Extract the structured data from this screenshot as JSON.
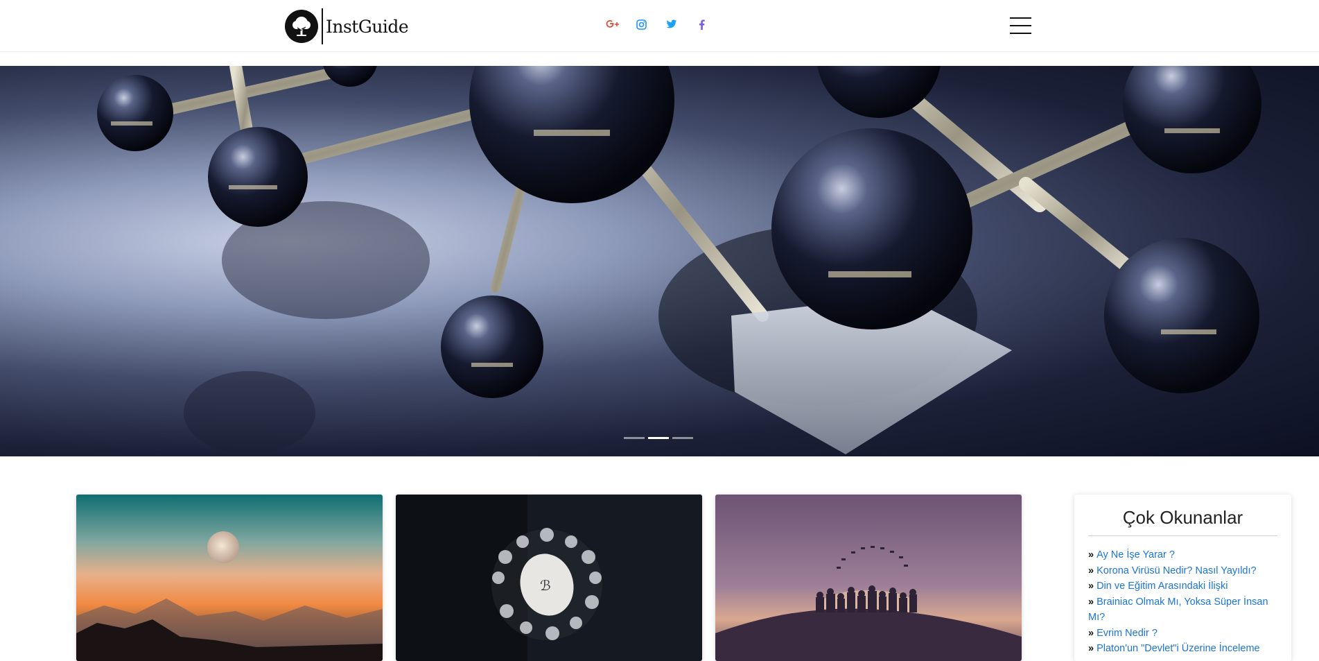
{
  "header": {
    "logo_text": "InstGuide",
    "logo_icon": "tree-icon",
    "social": [
      {
        "name": "google-plus-icon",
        "label": "G+",
        "color": "#dd4b39"
      },
      {
        "name": "instagram-icon",
        "color": "#1e90ff"
      },
      {
        "name": "twitter-icon",
        "color": "#1da1f2"
      },
      {
        "name": "facebook-icon",
        "color": "#7b5cf0"
      }
    ],
    "menu_icon": "hamburger-menu-icon"
  },
  "hero": {
    "image": "molecule-structure-image",
    "slides_count": 3,
    "active_slide": 2
  },
  "cards": [
    {
      "image": "moon-over-mountains-image"
    },
    {
      "image": "coronavirus-image"
    },
    {
      "image": "graduation-silhouette-image"
    }
  ],
  "sidebar": {
    "title": "Çok Okunanlar",
    "items": [
      {
        "label": "Ay Ne İşe Yarar ?"
      },
      {
        "label": "Korona Virüsü Nedir? Nasıl Yayıldı?"
      },
      {
        "label": "Din ve Eğitim Arasındaki İlişki"
      },
      {
        "label": "Brainiac Olmak Mı, Yoksa Süper İnsan Mı?"
      },
      {
        "label": "Evrim Nedir ?"
      },
      {
        "label": "Platon'un \"Devlet\"i Üzerine İnceleme"
      }
    ]
  },
  "colors": {
    "link": "#1a73d9",
    "text_dark": "#222222"
  }
}
